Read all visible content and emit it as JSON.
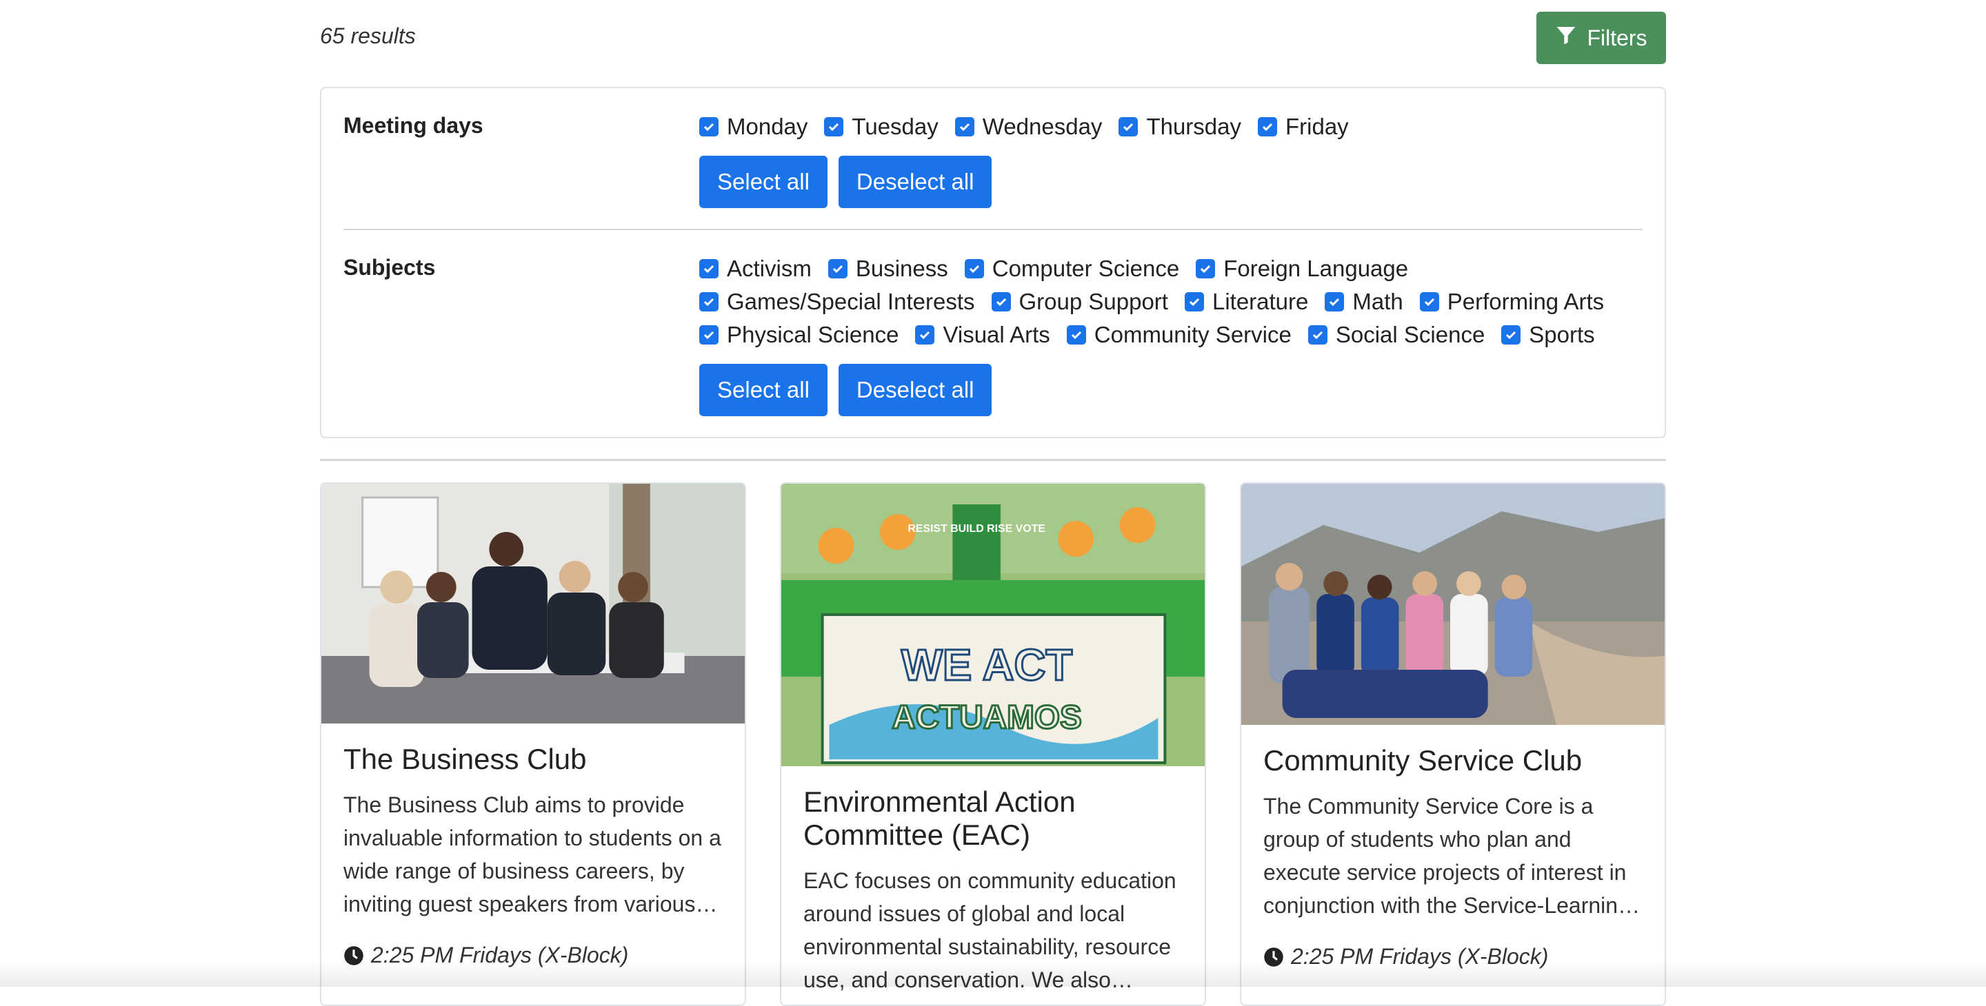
{
  "results": {
    "count_text": "65 results"
  },
  "filters_button": {
    "label": "Filters"
  },
  "meeting_days": {
    "label": "Meeting days",
    "options": [
      "Monday",
      "Tuesday",
      "Wednesday",
      "Thursday",
      "Friday"
    ],
    "select_all": "Select all",
    "deselect_all": "Deselect all"
  },
  "subjects": {
    "label": "Subjects",
    "rows": [
      [
        "Activism",
        "Business",
        "Computer Science",
        "Foreign Language"
      ],
      [
        "Games/Special Interests",
        "Group Support",
        "Literature",
        "Math",
        "Performing Arts"
      ],
      [
        "Physical Science",
        "Visual Arts",
        "Community Service",
        "Social Science",
        "Sports"
      ]
    ],
    "select_all": "Select all",
    "deselect_all": "Deselect all"
  },
  "cards": [
    {
      "title": "The Business Club",
      "description": "The Business Club aims to provide invaluable information to students on a wide range of business careers, by inviting guest speakers from various…",
      "time": "2:25 PM Fridays (X-Block)"
    },
    {
      "title": "Environmental Action Committee (EAC)",
      "description": "EAC focuses on community education around issues of global and local environmental sustainability, resource use, and conservation. We also…",
      "time": "",
      "image_text": {
        "banner_line1": "WE ACT",
        "banner_line2": "ACTUAMOS",
        "sign": "RESIST BUILD RISE VOTE"
      }
    },
    {
      "title": "Community Service Club",
      "description": "The Community Service Core is a group of students who plan and execute service projects of interest in conjunction with the Service-Learnin…",
      "time": "2:25 PM Fridays (X-Block)"
    }
  ],
  "colors": {
    "primary": "#1a73e8",
    "filters_green": "#4a8f5c"
  },
  "icons": {
    "filter": "funnel-icon",
    "checkbox": "checkmark-icon",
    "time": "clock-icon"
  }
}
